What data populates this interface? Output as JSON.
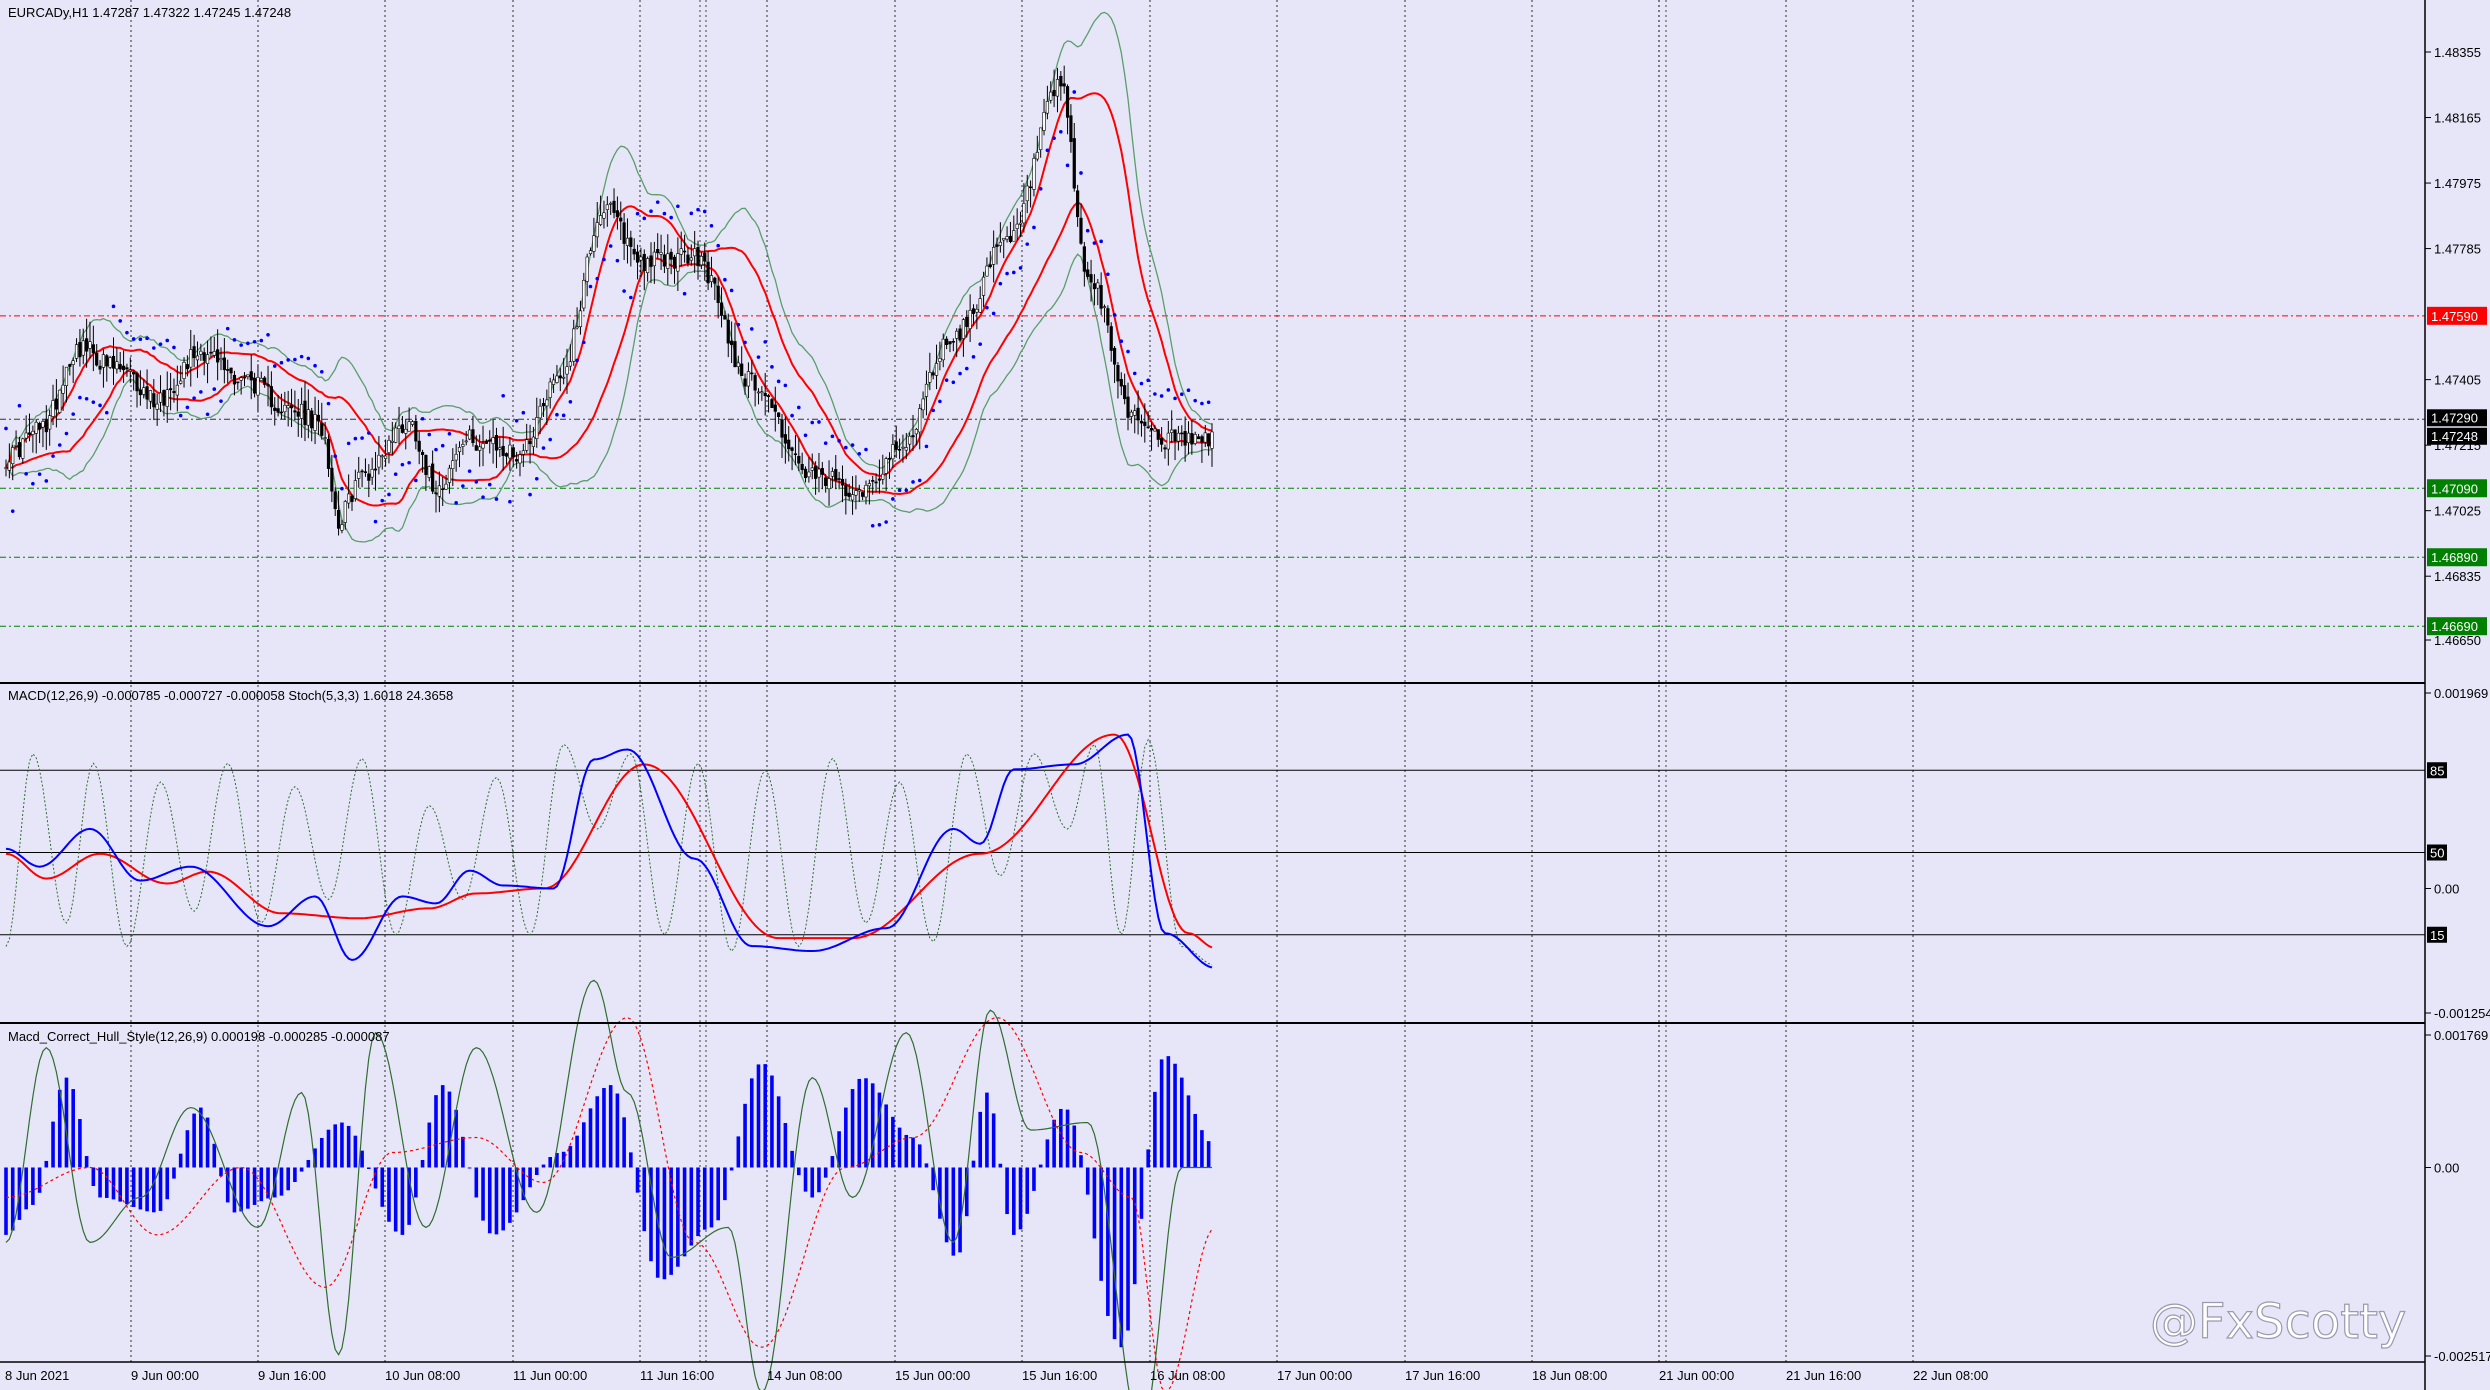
{
  "window": {
    "symbol_header": "EURCADy,H1  1.47287 1.47322 1.47245 1.47248",
    "indicator1_header": "MACD(12,26,9) -0.000785 -0.000727 -0.000058  Stoch(5,3,3) 1.6018 24.3658",
    "indicator2_header": "Macd_Correct_Hull_Style(12,26,9) 0.000198 -0.000285 -0.000087",
    "watermark": "@FxScotty"
  },
  "colors": {
    "background": "#e6e6f8",
    "bullish_candle": "#ffffff",
    "bearish_candle": "#000000",
    "bollinger": "#5a9e6a",
    "envelope": "#ff0000",
    "parabolic_sar": "#0000ff",
    "macd_main": "#0000ff",
    "macd_signal": "#ff0000",
    "stochastic": "#2f6e2f",
    "histogram": "#0000ff",
    "hull_line": "#2f6e2f",
    "hull_signal": "#ff0000",
    "red_level": "#ff0000",
    "green_level": "#008000"
  },
  "chart_data": [
    {
      "type": "candlestick",
      "name": "EURCADy,H1",
      "y_axis_ticks": [
        "1.48355",
        "1.48165",
        "1.47975",
        "1.47785",
        "1.47405",
        "1.47215",
        "1.47025",
        "1.46835",
        "1.46650"
      ],
      "ylim": [
        1.4657,
        1.4852
      ],
      "horizontal_levels": [
        {
          "value": 1.4759,
          "label": "1.47590",
          "style": "red"
        },
        {
          "value": 1.4709,
          "label": "1.47090",
          "style": "green"
        },
        {
          "value": 1.4689,
          "label": "1.46890",
          "style": "green"
        },
        {
          "value": 1.4669,
          "label": "1.46690",
          "style": "green"
        }
      ],
      "current_price_labels": [
        "1.47290",
        "1.47248"
      ],
      "current_price": 1.47248,
      "current_bid": 1.4729,
      "ohlc_keypoints": [
        [
          0,
          1.4718
        ],
        [
          10,
          1.4726
        ],
        [
          22,
          1.475
        ],
        [
          32,
          1.4744
        ],
        [
          45,
          1.4735
        ],
        [
          58,
          1.4749
        ],
        [
          70,
          1.4741
        ],
        [
          86,
          1.4731
        ],
        [
          94,
          1.4727
        ],
        [
          99,
          1.47
        ],
        [
          106,
          1.4713
        ],
        [
          120,
          1.4728
        ],
        [
          128,
          1.471
        ],
        [
          138,
          1.4723
        ],
        [
          152,
          1.4719
        ],
        [
          165,
          1.4742
        ],
        [
          178,
          1.479
        ],
        [
          190,
          1.4775
        ],
        [
          205,
          1.4776
        ],
        [
          222,
          1.474
        ],
        [
          240,
          1.4712
        ],
        [
          255,
          1.4709
        ],
        [
          265,
          1.4719
        ],
        [
          282,
          1.4753
        ],
        [
          298,
          1.478
        ],
        [
          314,
          1.4825
        ],
        [
          322,
          1.477
        ],
        [
          336,
          1.473
        ],
        [
          345,
          1.4723
        ]
      ],
      "indicators": [
        "Bollinger Bands",
        "Envelopes",
        "Parabolic SAR"
      ]
    },
    {
      "type": "line",
      "name": "MACD(12,26,9) + Stoch(5,3,3)",
      "y_axis_ticks": [
        "0.001969",
        "85",
        "50",
        "0.00",
        "15",
        "-0.001254"
      ],
      "series": [
        {
          "name": "MACD",
          "keypoints": [
            [
              0,
              0.0004
            ],
            [
              10,
              0.00022
            ],
            [
              25,
              0.0006
            ],
            [
              40,
              8e-05
            ],
            [
              55,
              0.00022
            ],
            [
              78,
              -0.00038
            ],
            [
              92,
              -8e-05
            ],
            [
              103,
              -0.00072
            ],
            [
              118,
              -8e-05
            ],
            [
              128,
              -0.00015
            ],
            [
              138,
              0.00018
            ],
            [
              148,
              3e-05
            ],
            [
              163,
              0.0
            ],
            [
              175,
              0.0013
            ],
            [
              185,
              0.0014
            ],
            [
              205,
              0.0003
            ],
            [
              222,
              -0.00058
            ],
            [
              240,
              -0.00063
            ],
            [
              262,
              -0.0004
            ],
            [
              282,
              0.0006
            ],
            [
              290,
              0.00045
            ],
            [
              300,
              0.0012
            ],
            [
              318,
              0.00125
            ],
            [
              334,
              0.00155
            ],
            [
              345,
              -0.00045
            ],
            [
              360,
              -0.0008
            ]
          ]
        },
        {
          "name": "Signal",
          "keypoints": [
            [
              0,
              0.00035
            ],
            [
              12,
              0.0001
            ],
            [
              28,
              0.00035
            ],
            [
              48,
              5e-05
            ],
            [
              60,
              0.00017
            ],
            [
              82,
              -0.00025
            ],
            [
              105,
              -0.0003
            ],
            [
              126,
              -0.0002
            ],
            [
              140,
              -5e-05
            ],
            [
              160,
              0.0
            ],
            [
              190,
              0.00125
            ],
            [
              230,
              -0.0005
            ],
            [
              252,
              -0.0005
            ],
            [
              290,
              0.00035
            ],
            [
              330,
              0.00155
            ],
            [
              352,
              -0.00045
            ],
            [
              360,
              -0.0006
            ]
          ]
        },
        {
          "name": "Stoch",
          "keypoints": [
            [
              0,
              10
            ],
            [
              8,
              92
            ],
            [
              18,
              20
            ],
            [
              26,
              88
            ],
            [
              36,
              10
            ],
            [
              46,
              80
            ],
            [
              56,
              25
            ],
            [
              66,
              88
            ],
            [
              76,
              20
            ],
            [
              86,
              78
            ],
            [
              96,
              30
            ],
            [
              106,
              90
            ],
            [
              116,
              15
            ],
            [
              126,
              70
            ],
            [
              136,
              30
            ],
            [
              146,
              82
            ],
            [
              156,
              15
            ],
            [
              166,
              96
            ],
            [
              176,
              60
            ],
            [
              186,
              92
            ],
            [
              196,
              15
            ],
            [
              206,
              88
            ],
            [
              216,
              8
            ],
            [
              226,
              85
            ],
            [
              236,
              10
            ],
            [
              246,
              90
            ],
            [
              256,
              20
            ],
            [
              266,
              80
            ],
            [
              276,
              12
            ],
            [
              286,
              92
            ],
            [
              296,
              40
            ],
            [
              306,
              92
            ],
            [
              316,
              60
            ],
            [
              324,
              96
            ],
            [
              332,
              15
            ],
            [
              340,
              98
            ],
            [
              350,
              10
            ],
            [
              360,
              2
            ]
          ]
        }
      ],
      "levels": [
        85,
        50,
        15
      ]
    },
    {
      "type": "bar",
      "name": "Macd_Correct_Hull_Style(12,26,9)",
      "y_axis_ticks": [
        "0.001769",
        "0.00",
        "-0.002517"
      ],
      "series": [
        {
          "name": "Histogram",
          "keypoints": [
            [
              0,
              -0.0009
            ],
            [
              8,
              -0.0005
            ],
            [
              18,
              0.0012
            ],
            [
              28,
              -0.0004
            ],
            [
              45,
              -0.0006
            ],
            [
              58,
              0.0008
            ],
            [
              68,
              -0.0006
            ],
            [
              80,
              -0.0004
            ],
            [
              100,
              0.0006
            ],
            [
              118,
              -0.0009
            ],
            [
              130,
              0.0011
            ],
            [
              145,
              -0.0009
            ],
            [
              165,
              0.0002
            ],
            [
              180,
              0.0011
            ],
            [
              195,
              -0.0015
            ],
            [
              210,
              -0.0008
            ],
            [
              225,
              0.0014
            ],
            [
              240,
              -0.0004
            ],
            [
              255,
              0.0012
            ],
            [
              270,
              0.0004
            ],
            [
              283,
              -0.0012
            ],
            [
              292,
              0.001
            ],
            [
              300,
              -0.0009
            ],
            [
              315,
              0.0008
            ],
            [
              332,
              -0.0024
            ],
            [
              345,
              0.0015
            ],
            [
              360,
              0.0003
            ]
          ]
        },
        {
          "name": "Hull line",
          "keypoints": [
            [
              0,
              -0.001
            ],
            [
              12,
              0.0016
            ],
            [
              25,
              -0.001
            ],
            [
              40,
              -0.0004
            ],
            [
              55,
              0.0008
            ],
            [
              75,
              -0.0008
            ],
            [
              88,
              0.001
            ],
            [
              99,
              -0.0025
            ],
            [
              110,
              0.0018
            ],
            [
              125,
              -0.0008
            ],
            [
              140,
              0.0016
            ],
            [
              158,
              -0.0006
            ],
            [
              175,
              0.0025
            ],
            [
              185,
              0.001
            ],
            [
              198,
              -0.0012
            ],
            [
              215,
              -0.0008
            ],
            [
              225,
              -0.003
            ],
            [
              240,
              0.0012
            ],
            [
              252,
              -0.0004
            ],
            [
              268,
              0.0018
            ],
            [
              282,
              -0.001
            ],
            [
              293,
              0.0021
            ],
            [
              305,
              0.0005
            ],
            [
              322,
              0.0006
            ],
            [
              338,
              -0.0035
            ],
            [
              350,
              0.0
            ],
            [
              360,
              0.0
            ]
          ]
        },
        {
          "name": "Hull signal",
          "keypoints": [
            [
              0,
              -0.0004
            ],
            [
              25,
              0.0
            ],
            [
              45,
              -0.0009
            ],
            [
              70,
              0.0
            ],
            [
              95,
              -0.0016
            ],
            [
              115,
              0.0002
            ],
            [
              140,
              0.0004
            ],
            [
              160,
              -0.0002
            ],
            [
              185,
              0.002
            ],
            [
              205,
              -0.001
            ],
            [
              225,
              -0.0024
            ],
            [
              250,
              0.0
            ],
            [
              270,
              0.0004
            ],
            [
              295,
              0.002
            ],
            [
              320,
              0.0002
            ],
            [
              335,
              -0.0004
            ],
            [
              345,
              -0.003
            ],
            [
              360,
              -0.0008
            ]
          ]
        }
      ]
    }
  ],
  "x_axis_labels": [
    "8 Jun 2021",
    "9 Jun 00:00",
    "9 Jun 16:00",
    "10 Jun 08:00",
    "11 Jun 00:00",
    "11 Jun 16:00",
    "14 Jun 08:00",
    "15 Jun 00:00",
    "15 Jun 16:00",
    "16 Jun 08:00",
    "17 Jun 00:00",
    "17 Jun 16:00",
    "18 Jun 08:00",
    "21 Jun 00:00",
    "21 Jun 16:00",
    "22 Jun 08:00"
  ],
  "candle_count": 360
}
